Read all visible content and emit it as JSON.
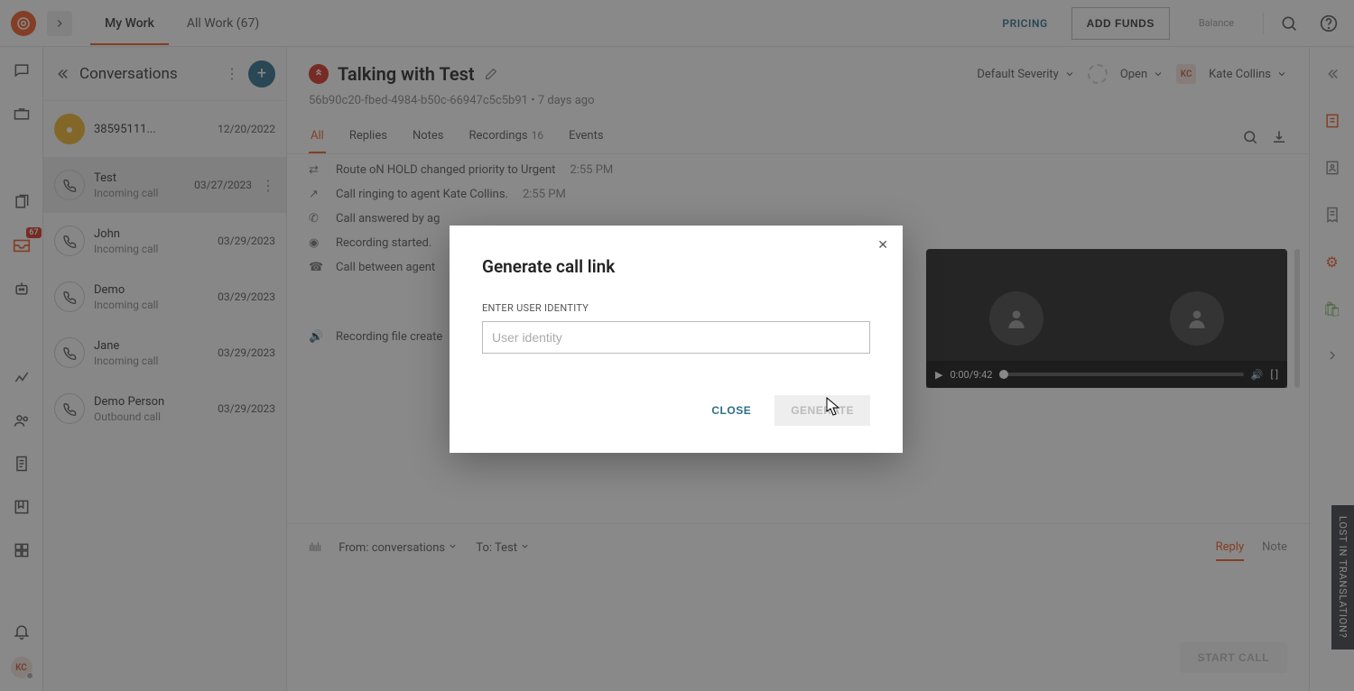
{
  "header": {
    "tabs": {
      "myWork": "My Work",
      "allWork": "All Work (67)"
    },
    "pricing": "PRICING",
    "addFunds": "ADD FUNDS",
    "balance": "Balance"
  },
  "leftRail": {
    "badge": "67",
    "userInitials": "KC"
  },
  "sidebar": {
    "title": "Conversations",
    "items": [
      {
        "name": "38595111...",
        "sub": "",
        "date": "12/20/2022",
        "pinned": true
      },
      {
        "name": "Test",
        "sub": "Incoming call",
        "date": "03/27/2023",
        "selected": true
      },
      {
        "name": "John",
        "sub": "Incoming call",
        "date": "03/29/2023"
      },
      {
        "name": "Demo",
        "sub": "Incoming call",
        "date": "03/29/2023"
      },
      {
        "name": "Jane",
        "sub": "Incoming call",
        "date": "03/29/2023"
      },
      {
        "name": "Demo Person",
        "sub": "Outbound call",
        "date": "03/29/2023"
      }
    ]
  },
  "content": {
    "title": "Talking with Test",
    "id": "56b90c20-fbed-4984-b50c-66947c5c5b91",
    "age": "7 days ago",
    "severity": "Default Severity",
    "status": "Open",
    "assigneeInitials": "KC",
    "assigneeName": "Kate Collins",
    "tabs": {
      "all": "All",
      "replies": "Replies",
      "notes": "Notes",
      "recordings": "Recordings",
      "recordingsCount": "16",
      "events": "Events"
    },
    "events": [
      {
        "text": "Route oN HOLD changed priority to Urgent",
        "time": "2:55 PM"
      },
      {
        "text": "Call ringing to agent Kate Collins.",
        "time": "2:55 PM"
      },
      {
        "text": "Call answered by ag",
        "time": ""
      },
      {
        "text": "Recording started.",
        "time": ""
      },
      {
        "text": "Call between agent",
        "time": ""
      },
      {
        "text": "Recording file create",
        "time": ""
      }
    ],
    "video": {
      "current": "0:00",
      "total": "9:42"
    }
  },
  "reply": {
    "fromLabel": "From:",
    "fromValue": "conversations",
    "toLabel": "To:",
    "toValue": "Test",
    "tabs": {
      "reply": "Reply",
      "note": "Note"
    },
    "startCall": "START CALL"
  },
  "modal": {
    "title": "Generate call link",
    "label": "ENTER USER IDENTITY",
    "placeholder": "User identity",
    "close": "CLOSE",
    "generate": "GENERATE"
  },
  "feedback": "LOST IN TRANSLATION?"
}
